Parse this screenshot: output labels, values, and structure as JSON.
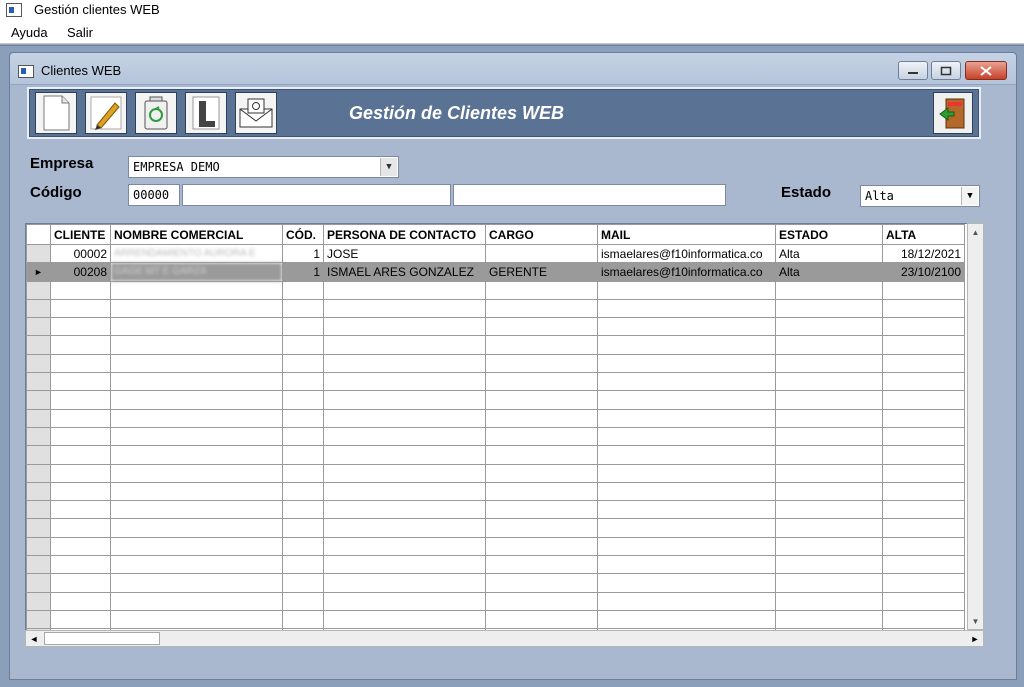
{
  "app": {
    "title": "Gestión clientes WEB"
  },
  "menu": [
    {
      "label": "Ayuda"
    },
    {
      "label": "Salir"
    }
  ],
  "child_window": {
    "title": "Clientes WEB"
  },
  "toolbar": {
    "title": "Gestión de Clientes WEB"
  },
  "form": {
    "empresa_label": "Empresa",
    "empresa_value": "EMPRESA DEMO",
    "codigo_label": "Código",
    "codigo_value": "00000",
    "estado_label": "Estado",
    "estado_value": "Alta"
  },
  "table": {
    "columns": [
      "CLIENTE",
      "NOMBRE COMERCIAL",
      "CÓD.",
      "PERSONA DE CONTACTO",
      "CARGO",
      "MAIL",
      "ESTADO",
      "ALTA"
    ],
    "rows": [
      {
        "cliente": "00002",
        "nombre": "ARRENDAMIENTO AURORA E",
        "cod": "1",
        "contacto": "JOSE",
        "cargo": "",
        "mail": "ismaelares@f10informatica.co",
        "estado": "Alta",
        "alta": "18/12/2021"
      },
      {
        "cliente": "00208",
        "nombre": "GAGE MT E GARZA",
        "cod": "1",
        "contacto": "ISMAEL ARES GONZALEZ",
        "cargo": "GERENTE",
        "mail": "ismaelares@f10informatica.co",
        "estado": "Alta",
        "alta": "23/10/2100"
      }
    ],
    "empty_rows": 20,
    "current_row_marker": "►"
  },
  "colors": {
    "toolbar_bg": "#5a7293",
    "selected_row": "#9a9a9a",
    "mdi_bg": "#8b9fbb"
  },
  "icons": [
    "new-document-icon",
    "edit-pencil-icon",
    "recycle-icon",
    "list-report-icon",
    "email-icon",
    "exit-door-icon"
  ]
}
